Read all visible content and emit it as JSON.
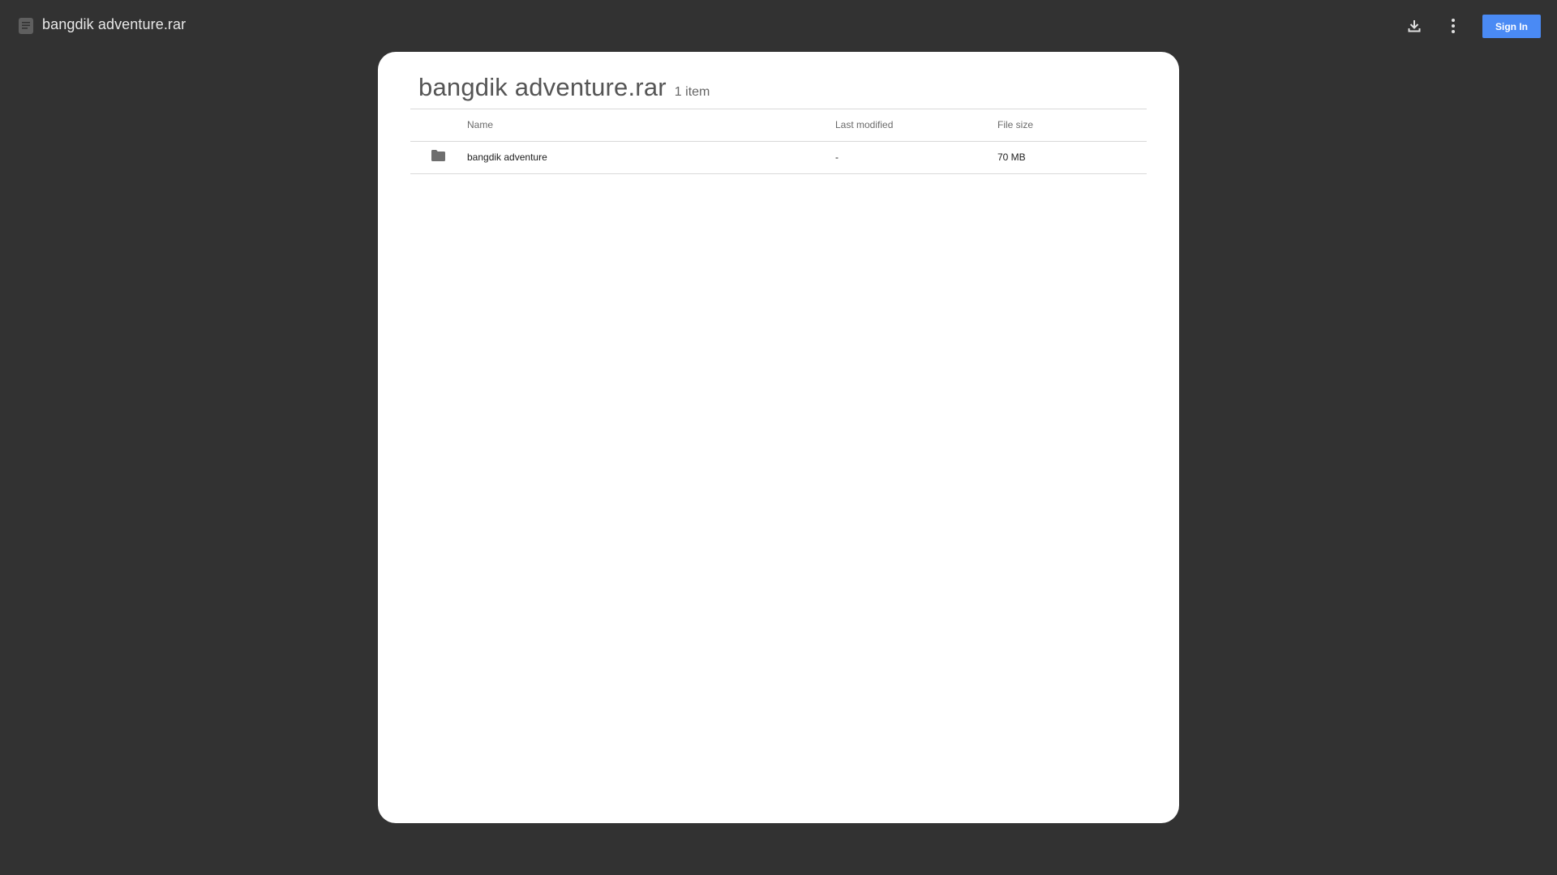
{
  "header": {
    "title": "bangdik adventure.rar",
    "file_icon": "document-icon",
    "download_icon": "download-icon",
    "more_icon": "more-vert-icon",
    "sign_in_label": "Sign In",
    "sign_in_color": "#4a8af4"
  },
  "archive": {
    "title": "bangdik adventure.rar",
    "item_count": "1 item",
    "columns": {
      "name": "Name",
      "last_modified": "Last modified",
      "file_size": "File size"
    },
    "rows": [
      {
        "icon": "folder-icon",
        "name": "bangdik adventure",
        "last_modified": "-",
        "file_size": "70 MB"
      }
    ]
  },
  "colors": {
    "background": "#323232",
    "card": "#ffffff",
    "accent": "#4a8af4"
  }
}
